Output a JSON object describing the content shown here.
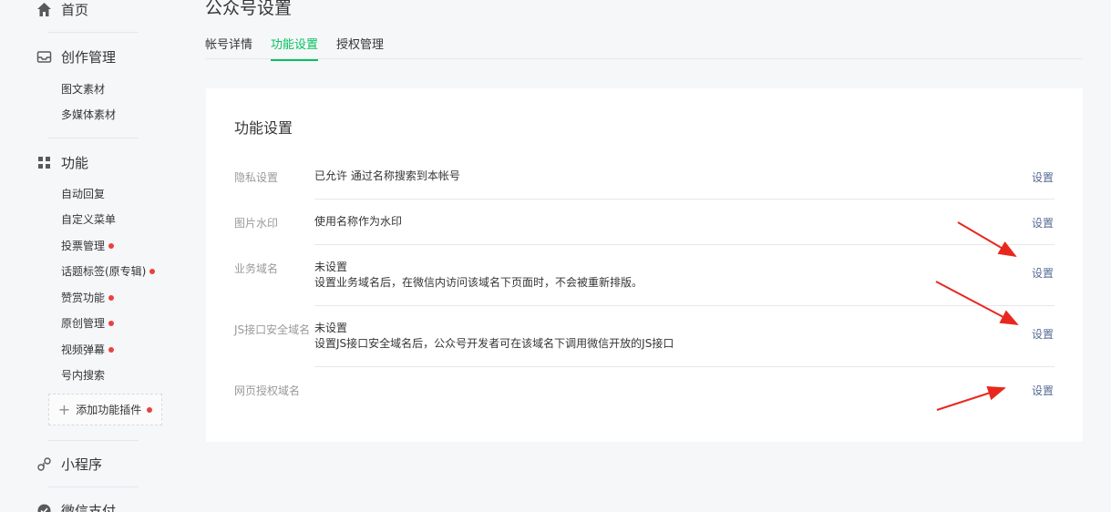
{
  "sidebar": {
    "home": "首页",
    "creation": "创作管理",
    "creation_items": [
      "图文素材",
      "多媒体素材"
    ],
    "function": "功能",
    "function_items": [
      {
        "label": "自动回复",
        "dot": false
      },
      {
        "label": "自定义菜单",
        "dot": false
      },
      {
        "label": "投票管理",
        "dot": true
      },
      {
        "label": "话题标签(原专辑)",
        "dot": true
      },
      {
        "label": "赞赏功能",
        "dot": true
      },
      {
        "label": "原创管理",
        "dot": true
      },
      {
        "label": "视频弹幕",
        "dot": true
      },
      {
        "label": "号内搜索",
        "dot": false
      }
    ],
    "add_plugin": "添加功能插件",
    "mini_program": "小程序",
    "wechat_pay": "微信支付"
  },
  "header": {
    "title": "公众号设置",
    "tabs": [
      "帐号详情",
      "功能设置",
      "授权管理"
    ],
    "active_tab": "功能设置"
  },
  "card": {
    "title": "功能设置",
    "rows": [
      {
        "label": "隐私设置",
        "value": "已允许 通过名称搜索到本帐号",
        "desc": "",
        "action": "设置"
      },
      {
        "label": "图片水印",
        "value": "使用名称作为水印",
        "desc": "",
        "action": "设置"
      },
      {
        "label": "业务域名",
        "value": "未设置",
        "desc": "设置业务域名后，在微信内访问该域名下页面时，不会被重新排版。",
        "action": "设置"
      },
      {
        "label": "JS接口安全域名",
        "value": "未设置",
        "desc": "设置JS接口安全域名后，公众号开发者可在该域名下调用微信开放的JS接口",
        "action": "设置"
      },
      {
        "label": "网页授权域名",
        "value": "",
        "desc": "",
        "action": "设置"
      }
    ]
  },
  "colors": {
    "accent": "#07c160",
    "link": "#576b95",
    "dot": "#e64340",
    "annotation_arrow": "#e8281e"
  },
  "icons": [
    "home-icon",
    "inbox-icon",
    "grid-icon",
    "link-icon",
    "pay-icon"
  ]
}
